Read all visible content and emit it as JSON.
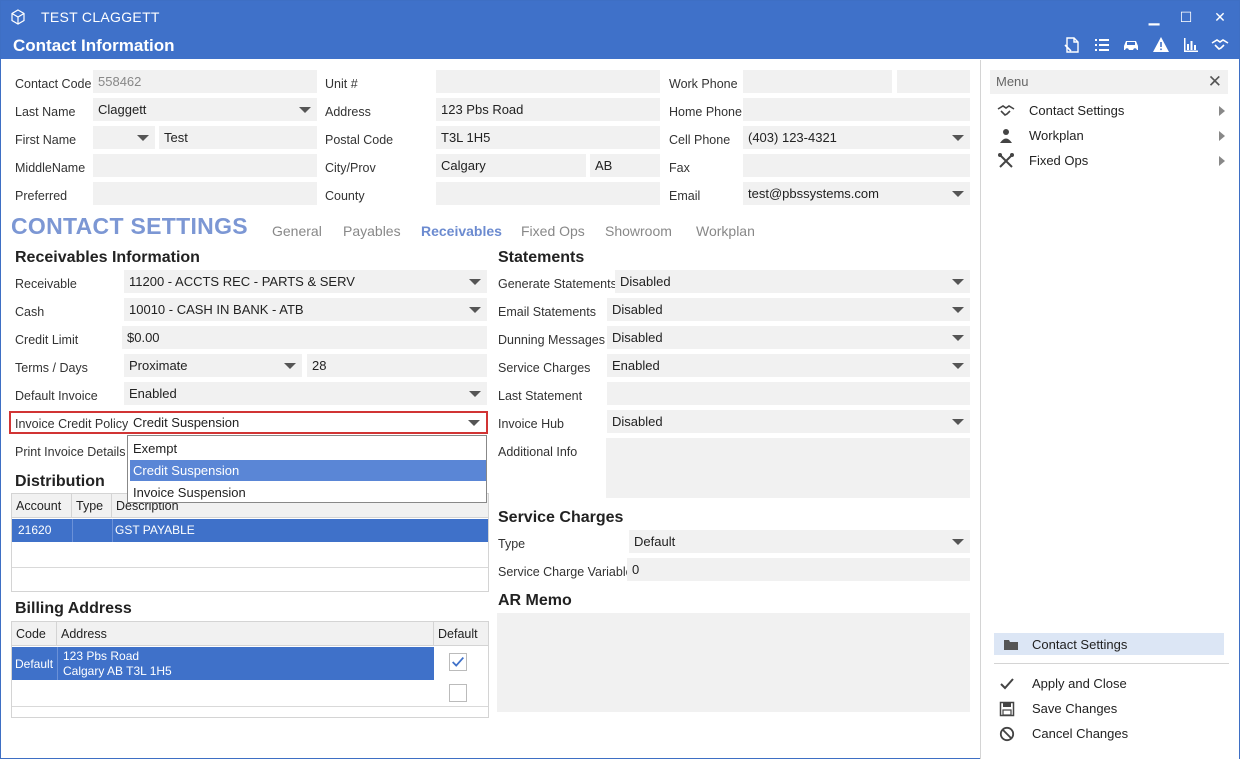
{
  "window": {
    "title": "TEST CLAGGETT",
    "subtitle": "Contact Information",
    "minimize": "▁",
    "maximize": "☐",
    "close": "✕"
  },
  "contact": {
    "contact_code_label": "Contact Code",
    "contact_code": "558462",
    "last_name_label": "Last Name",
    "last_name": "Claggett",
    "first_name_label": "First Name",
    "first_name": "Test",
    "middle_name_label": "MiddleName",
    "middle_name": "",
    "preferred_label": "Preferred",
    "preferred": "",
    "unit_label": "Unit #",
    "unit": "",
    "address_label": "Address",
    "address": "123 Pbs Road",
    "postal_label": "Postal Code",
    "postal": "T3L 1H5",
    "city_label": "City/Prov",
    "city": "Calgary",
    "prov": "AB",
    "county_label": "County",
    "county": "",
    "work_phone_label": "Work Phone",
    "work_phone": "",
    "home_phone_label": "Home Phone",
    "home_phone": "",
    "cell_phone_label": "Cell Phone",
    "cell_phone": "(403) 123-4321",
    "fax_label": "Fax",
    "fax": "",
    "email_label": "Email",
    "email": "test@pbssystems.com"
  },
  "settings": {
    "title": "CONTACT SETTINGS",
    "tabs": [
      "General",
      "Payables",
      "Receivables",
      "Fixed Ops",
      "Showroom",
      "Workplan"
    ],
    "active_tab": "Receivables"
  },
  "receivables": {
    "heading": "Receivables Information",
    "receivable_label": "Receivable",
    "receivable": "11200 - ACCTS REC - PARTS & SERV",
    "cash_label": "Cash",
    "cash": "10010 - CASH IN BANK - ATB",
    "credit_limit_label": "Credit Limit",
    "credit_limit": "$0.00",
    "terms_label": "Terms / Days",
    "terms": "Proximate",
    "days": "28",
    "default_invoice_label": "Default Invoice",
    "default_invoice": "Enabled",
    "credit_policy_label": "Invoice Credit Policy",
    "credit_policy": "Credit Suspension",
    "print_details_label": "Print Invoice Details",
    "credit_policy_options": [
      "Exempt",
      "Credit Suspension",
      "Invoice Suspension"
    ]
  },
  "distribution": {
    "heading": "Distribution",
    "columns": [
      "Account",
      "Type",
      "Description"
    ],
    "rows": [
      {
        "account": "21620",
        "type": "",
        "description": "GST PAYABLE"
      }
    ]
  },
  "billing": {
    "heading": "Billing Address",
    "columns": [
      "Code",
      "Address",
      "Default"
    ],
    "rows": [
      {
        "code": "Default",
        "line1": "123 Pbs Road",
        "line2": "Calgary AB  T3L 1H5",
        "default": true
      }
    ]
  },
  "statements": {
    "heading": "Statements",
    "generate_label": "Generate Statements",
    "generate": "Disabled",
    "email_label": "Email Statements",
    "email": "Disabled",
    "dunning_label": "Dunning Messages",
    "dunning": "Disabled",
    "service_charges_label": "Service Charges",
    "service_charges": "Enabled",
    "last_statement_label": "Last Statement",
    "last_statement": "",
    "invoice_hub_label": "Invoice Hub",
    "invoice_hub": "Disabled",
    "additional_info_label": "Additional Info"
  },
  "service_charges": {
    "heading": "Service Charges",
    "type_label": "Type",
    "type": "Default",
    "variable_label": "Service Charge Variable",
    "variable": "0"
  },
  "ar_memo": {
    "heading": "AR Memo"
  },
  "menu": {
    "header": "Menu",
    "items": [
      "Contact Settings",
      "Workplan",
      "Fixed Ops"
    ],
    "current": "Contact Settings",
    "actions": [
      "Apply and Close",
      "Save Changes",
      "Cancel Changes"
    ]
  },
  "colors": {
    "titlebar": "#3f71c9",
    "selection": "#3f71c9",
    "accent_title": "#7c97d4",
    "highlight_border": "#d13434"
  }
}
